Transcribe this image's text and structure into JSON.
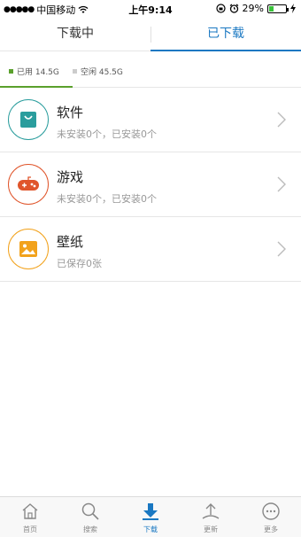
{
  "status_bar": {
    "signal_dots": "●●●●●",
    "carrier": "中国移动",
    "time": "上午9:14",
    "battery": "29%",
    "battery_level": 0.29
  },
  "tabs": [
    {
      "label": "下载中",
      "active": false
    },
    {
      "label": "已下载",
      "active": true
    }
  ],
  "storage": {
    "used": "已用 14.5G",
    "free": "空闲 45.5G",
    "used_color": "#5aa02c",
    "free_color": "#cccccc"
  },
  "categories": [
    {
      "title": "软件",
      "subtitle": "未安装0个，已安装0个",
      "icon": "app-store-bag-icon",
      "color": "#2a9d9d"
    },
    {
      "title": "游戏",
      "subtitle": "未安装0个，已安装0个",
      "icon": "gamepad-icon",
      "color": "#e0552b"
    },
    {
      "title": "壁纸",
      "subtitle": "已保存0张",
      "icon": "picture-icon",
      "color": "#f2a21c"
    }
  ],
  "nav": [
    {
      "label": "首页",
      "icon": "home-icon",
      "active": false
    },
    {
      "label": "搜索",
      "icon": "search-icon",
      "active": false
    },
    {
      "label": "下载",
      "icon": "download-icon",
      "active": true
    },
    {
      "label": "更新",
      "icon": "update-upload-icon",
      "active": false
    },
    {
      "label": "更多",
      "icon": "more-icon",
      "active": false
    }
  ],
  "colors": {
    "accent": "#1a78c2"
  }
}
